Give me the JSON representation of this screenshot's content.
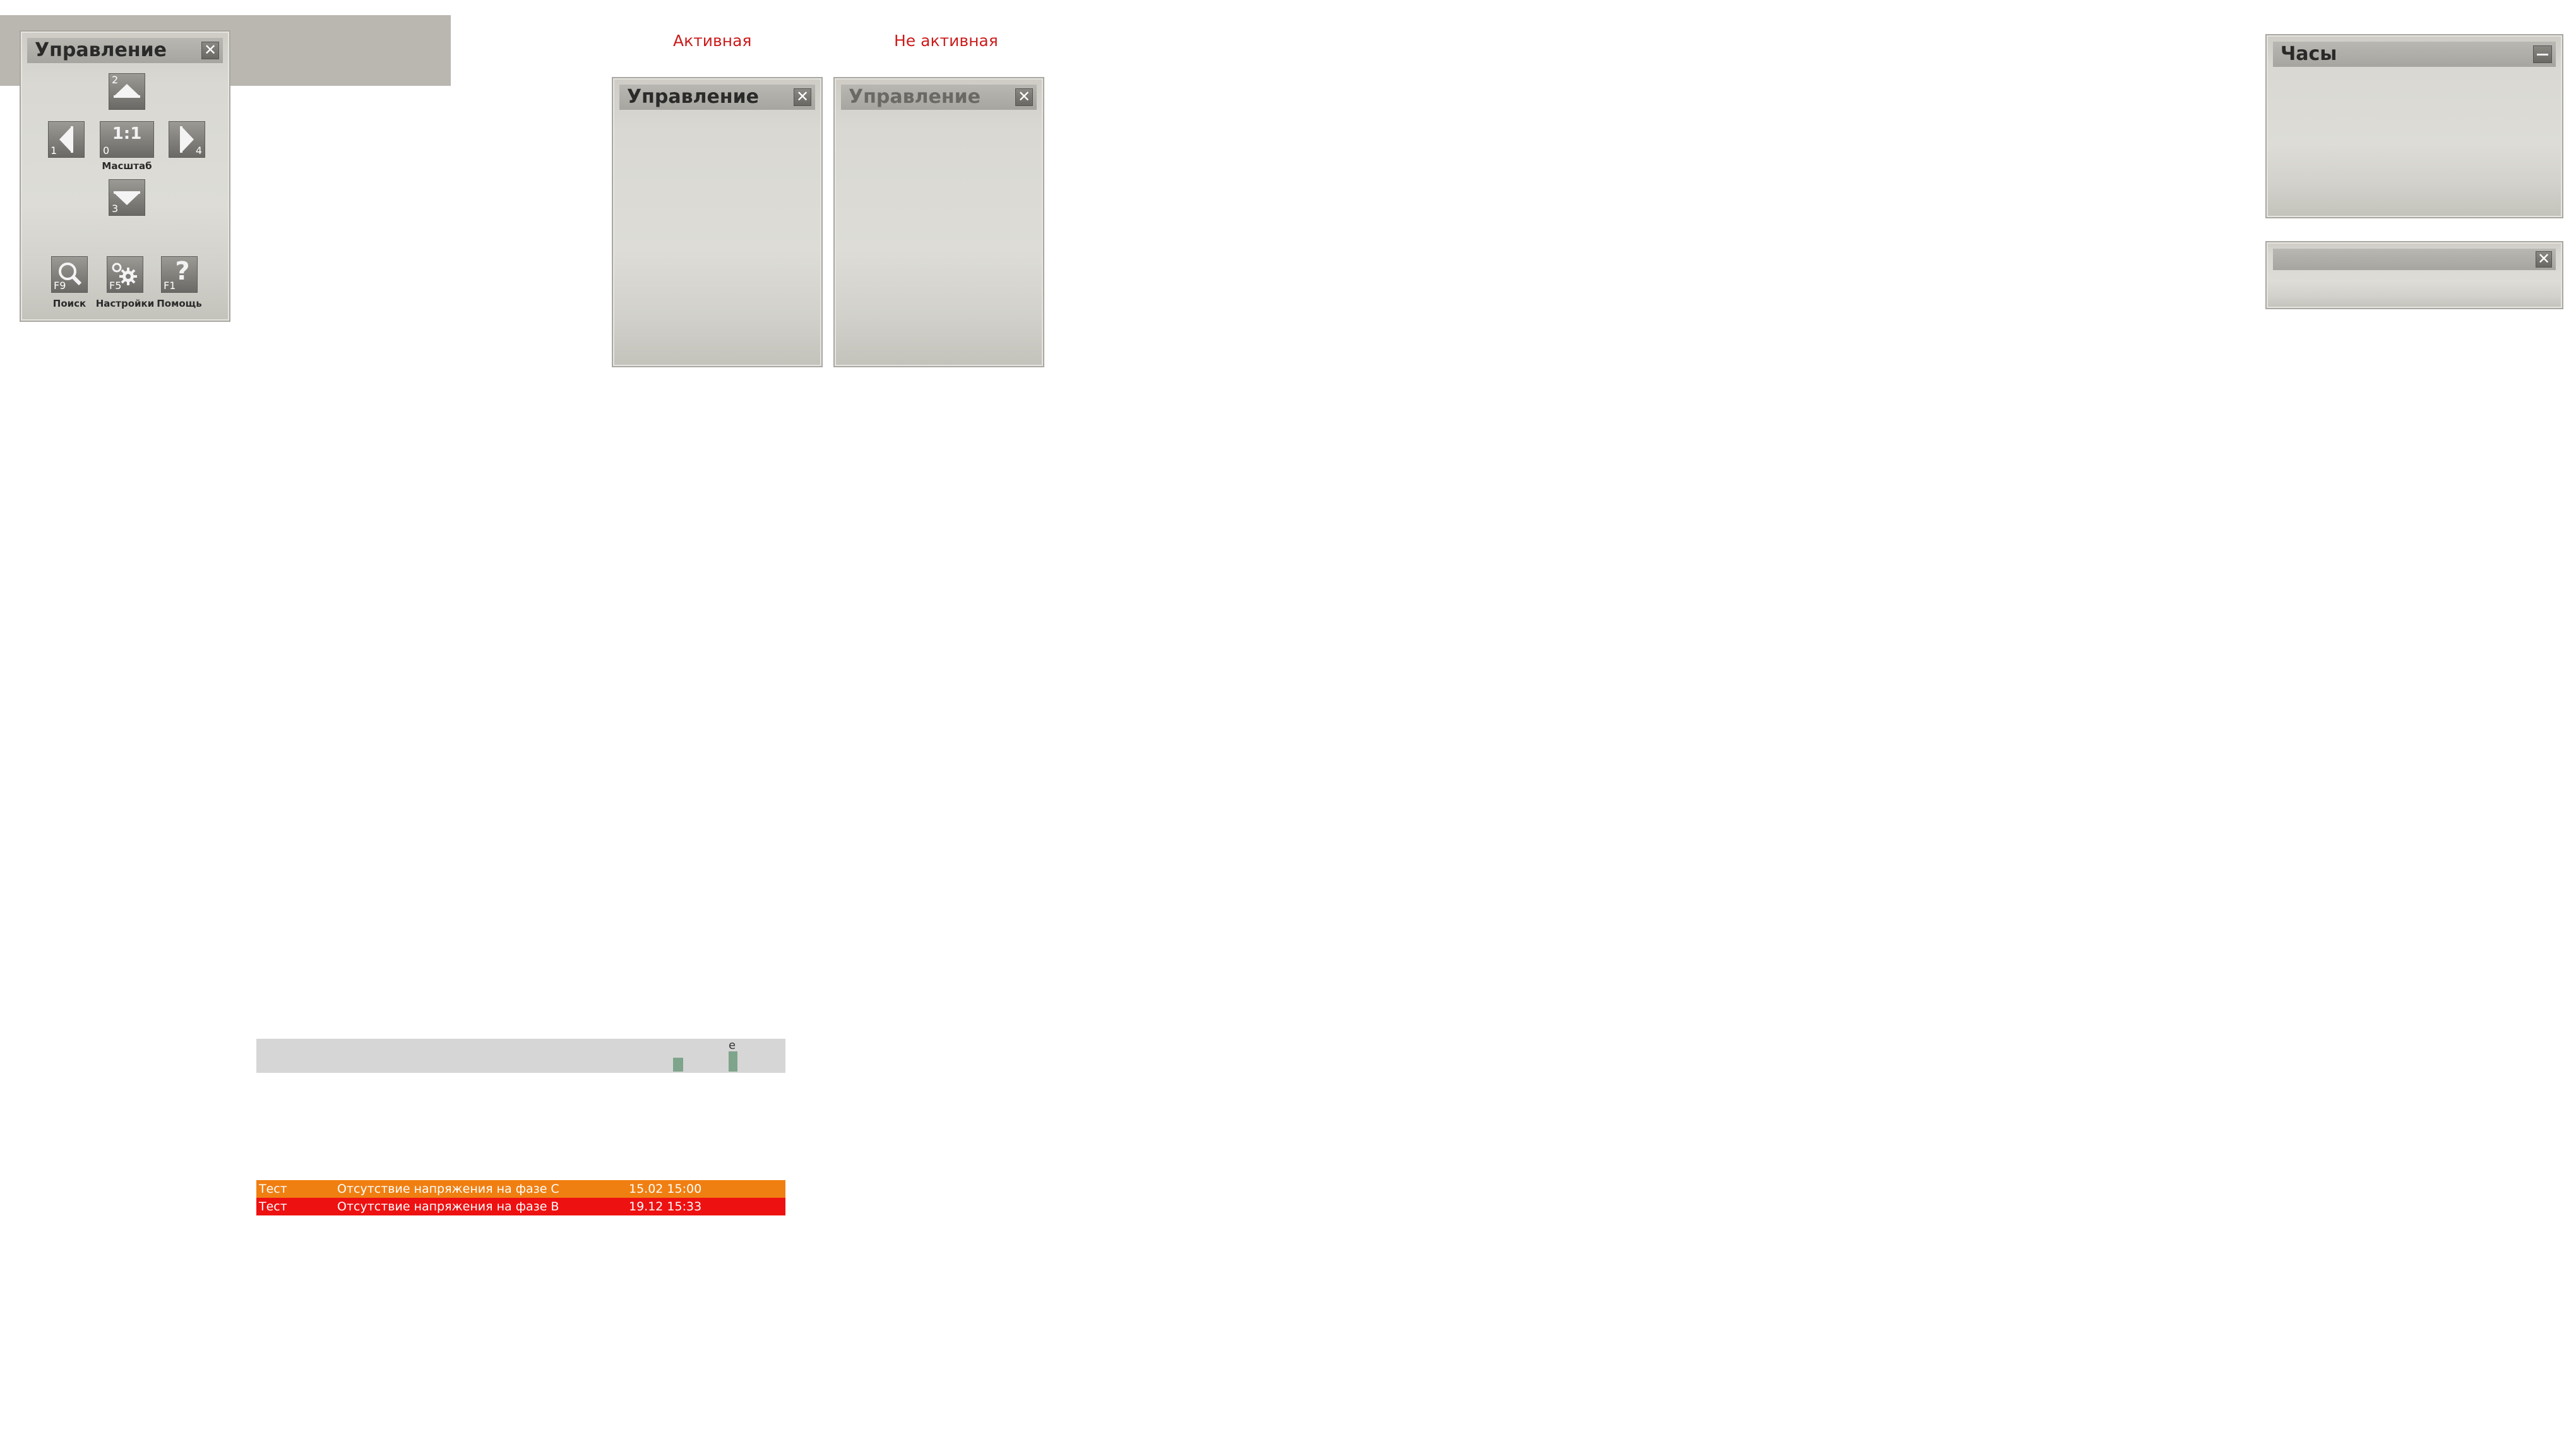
{
  "labels": {
    "active": "Активная",
    "inactive": "Не активная"
  },
  "control_panel": {
    "title": "Управление",
    "close_label": "✕",
    "up_key": "2",
    "left_key": "1",
    "scale_key": "0",
    "scale_text": "1:1",
    "scale_caption": "Масштаб",
    "right_key": "4",
    "down_key": "3",
    "search": {
      "key": "F9",
      "caption": "Поиск"
    },
    "settings": {
      "key": "F5",
      "caption": "Настройки"
    },
    "help": {
      "key": "F1",
      "caption": "Помощь",
      "glyph": "?"
    }
  },
  "active_panel": {
    "title": "Управление",
    "close_label": "✕"
  },
  "inactive_panel": {
    "title": "Управление",
    "close_label": "✕"
  },
  "clock_panel": {
    "title": "Часы"
  },
  "small_panel": {
    "close_label": "✕"
  },
  "status_bar": {
    "indicator_label": "e",
    "indicator_color": "#7ea48b"
  },
  "alarms": [
    {
      "source": "Тест",
      "message": "Отсутствие напряжения на фазе C",
      "time": "15.02 15:00",
      "color": "#f07f12"
    },
    {
      "source": "Тест",
      "message": "Отсутствие напряжения на фазе B",
      "time": "19.12 15:33",
      "color": "#ee1111"
    }
  ],
  "colors": {
    "accent_red": "#cc1b1b",
    "panel_gray": "#d9d8d2"
  }
}
